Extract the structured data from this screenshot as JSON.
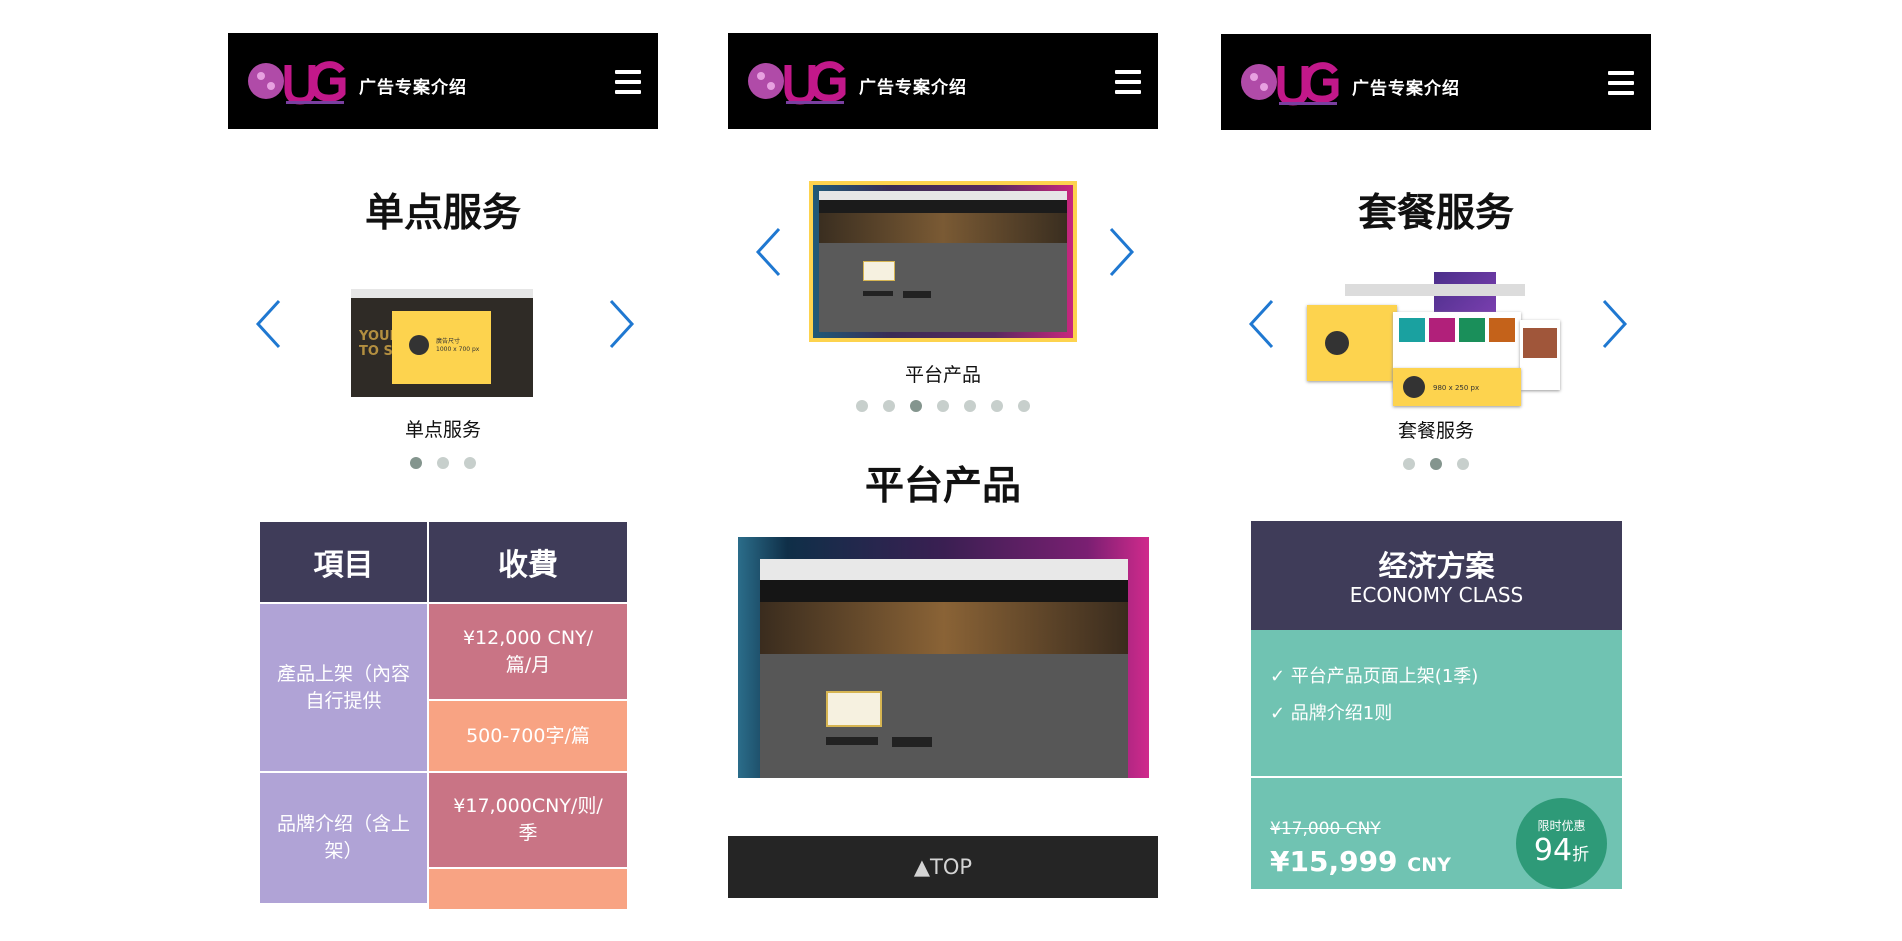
{
  "header": {
    "title": "广告专案介绍"
  },
  "panel1": {
    "section_title": "单点服务",
    "slide_caption": "单点服务",
    "thumb_label": "廣告尺寸",
    "thumb_size": "1000 x 700 px",
    "dots_total": 3,
    "dots_active": 1,
    "table": {
      "col1_header": "項目",
      "col2_header": "收費",
      "row1_item": "產品上架（內容自行提供",
      "row1_price1": "¥12,000 CNY/篇/月",
      "row1_price2": "500-700字/篇",
      "row2_item": "品牌介绍（含上架）",
      "row2_price1": "¥17,000CNY/则/季"
    }
  },
  "panel2": {
    "slide_caption": "平台产品",
    "dots_total": 7,
    "dots_active": 3,
    "section_title": "平台产品",
    "top_button": "▲TOP"
  },
  "panel3": {
    "section_title": "套餐服务",
    "slide_caption": "套餐服务",
    "thumb_size": "980 x 250 px",
    "dots_total": 3,
    "dots_active": 2,
    "card": {
      "title_cn": "经济方案",
      "title_en": "ECONOMY CLASS",
      "feature1": "✓ 平台产品页面上架(1季)",
      "feature2": "✓ 品牌介绍1则",
      "old_price": "¥17,000 CNY",
      "new_price": "¥15,999",
      "currency": "CNY",
      "badge_top": "限时优惠",
      "badge_num": "94",
      "badge_suffix": "折"
    }
  },
  "colors": {
    "header_bg": "#000000",
    "table_header": "#3f3c59",
    "item_cell": "#b0a3d6",
    "price_rose": "#c97485",
    "price_salmon": "#f8a383",
    "eco_teal": "#70c3b2",
    "badge_green": "#2e9a78",
    "arrow_blue": "#1f78d1",
    "highlight_yellow": "#fdd34e"
  },
  "icons": [
    "ug-logo",
    "hamburger-icon",
    "chevron-left-icon",
    "chevron-right-icon"
  ]
}
